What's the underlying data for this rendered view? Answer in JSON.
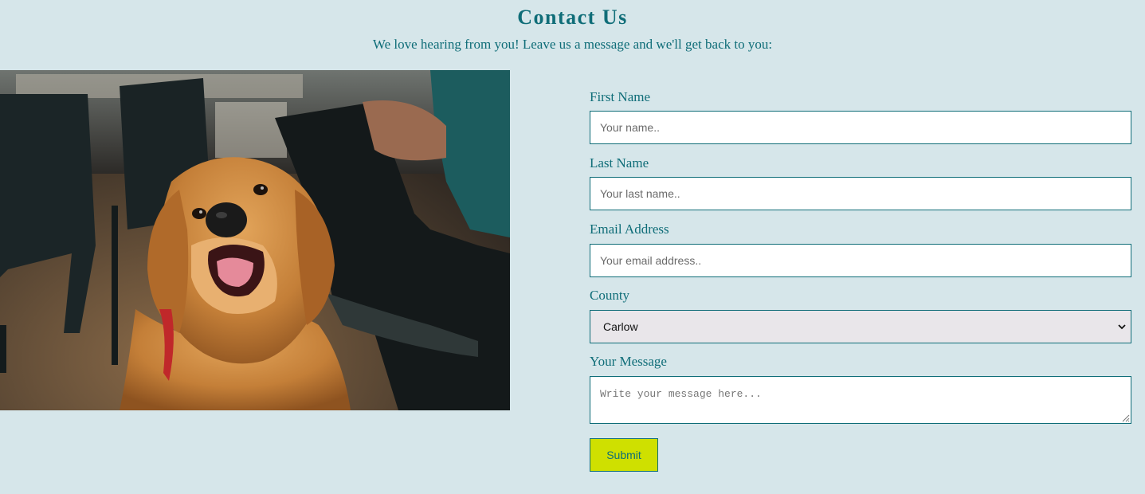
{
  "header": {
    "title": "Contact Us",
    "subtitle": "We love hearing from you! Leave us a message and we'll get back to you:"
  },
  "image": {
    "subject": "golden retriever dog smiling in a cafe"
  },
  "form": {
    "first_name": {
      "label": "First Name",
      "placeholder": "Your name..",
      "value": ""
    },
    "last_name": {
      "label": "Last Name",
      "placeholder": "Your last name..",
      "value": ""
    },
    "email": {
      "label": "Email Address",
      "placeholder": "Your email address..",
      "value": ""
    },
    "county": {
      "label": "County",
      "selected": "Carlow",
      "icon": "chevron-down-icon"
    },
    "message": {
      "label": "Your Message",
      "placeholder": "Write your message here...",
      "value": ""
    },
    "submit_label": "Submit"
  },
  "colors": {
    "background": "#d6e6ea",
    "accent": "#0f6d78",
    "button": "#cfe000"
  }
}
